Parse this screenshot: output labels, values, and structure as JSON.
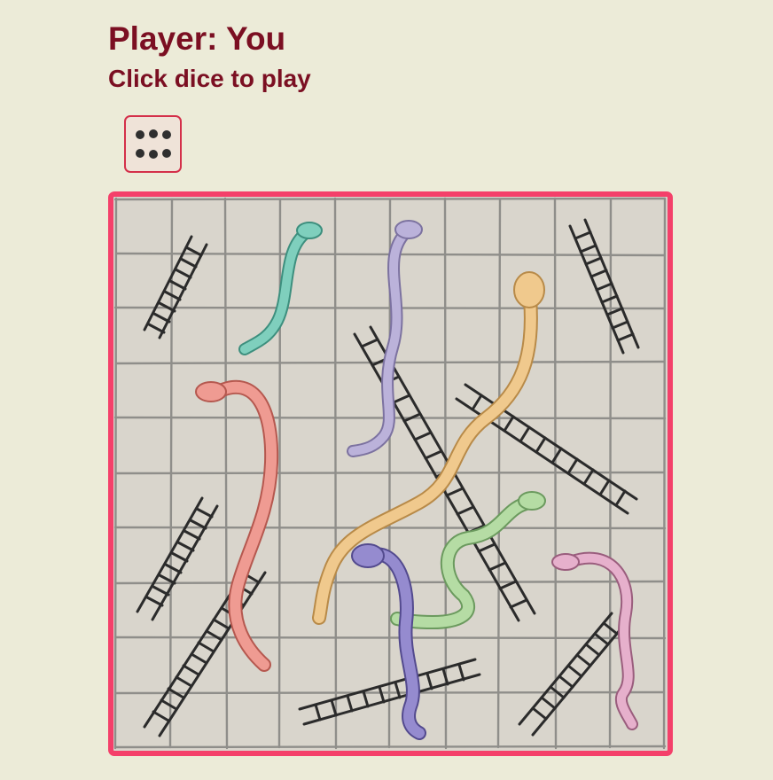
{
  "header": {
    "player_line": "Player: You",
    "instruction": "Click dice to play"
  },
  "dice": {
    "face_value": 6,
    "icon": "dice-six-icon"
  },
  "board": {
    "grid_rows": 10,
    "grid_cols": 10,
    "colors": {
      "border": "#f4406a",
      "paper": "#d9d5cc",
      "grid": "#8f8e8a",
      "ladder": "#2b2b2b",
      "snake_teal": "#5fb8a4",
      "snake_lavender": "#a89ec8",
      "snake_orange": "#e7b97c",
      "snake_red": "#e3857c",
      "snake_green": "#9cc88a",
      "snake_purple": "#7f74b8",
      "snake_pink": "#d796b6"
    }
  }
}
